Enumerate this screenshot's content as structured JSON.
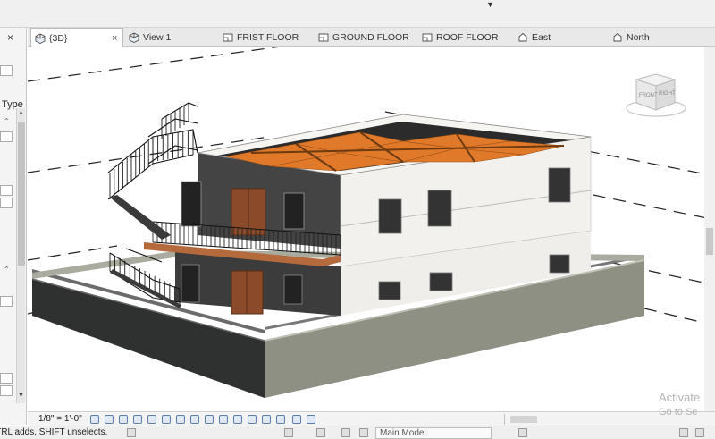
{
  "ribbon": {
    "expand_glyph": "▼"
  },
  "properties_panel": {
    "close_glyph": "×",
    "type_label": "Type",
    "collapse_glyph": "⌃"
  },
  "tabs": [
    {
      "label": "{3D}",
      "icon": "3d-view-icon",
      "active": true,
      "close_glyph": "×"
    },
    {
      "label": "View 1",
      "icon": "3d-view-icon"
    },
    {
      "label": "FRIST FLOOR",
      "icon": "floor-plan-icon"
    },
    {
      "label": "GROUND FLOOR",
      "icon": "floor-plan-icon"
    },
    {
      "label": "ROOF FLOOR",
      "icon": "floor-plan-icon"
    },
    {
      "label": "East",
      "icon": "elevation-icon"
    },
    {
      "label": "North",
      "icon": "elevation-icon"
    }
  ],
  "viewcube": {
    "faces": [
      "FRONT",
      "RIGHT"
    ]
  },
  "view_control_bar": {
    "scale": "1/8\" = 1'-0\""
  },
  "watermark": {
    "line1": "Activate",
    "line2": "Go to Se"
  },
  "status_bar": {
    "hint": "CTRL adds, SHIFT unselects.",
    "model": "Main Model"
  },
  "colors": {
    "wall_white": "#f2f1ee",
    "wall_shadow": "#4a4a4a",
    "beam_orange": "#e07a2a",
    "door_brown": "#8b4a2a",
    "balcony_wood": "#b46a3c",
    "boundary_wall": "#8f9185"
  }
}
